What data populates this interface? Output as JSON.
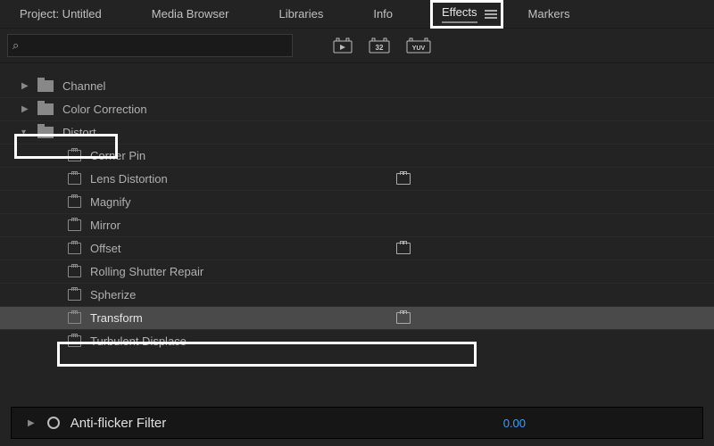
{
  "tabs": {
    "project": "Project: Untitled",
    "media": "Media Browser",
    "libraries": "Libraries",
    "info": "Info",
    "effects": "Effects",
    "markers": "Markers"
  },
  "search": {
    "placeholder": ""
  },
  "badges": {
    "b32": "32",
    "yuv": "YUV"
  },
  "tree": {
    "channel": "Channel",
    "color_correction": "Color Correction",
    "distort": "Distort",
    "items": {
      "corner_pin": "Corner Pin",
      "lens_distortion": "Lens Distortion",
      "magnify": "Magnify",
      "mirror": "Mirror",
      "offset": "Offset",
      "rolling_shutter": "Rolling Shutter Repair",
      "spherize": "Spherize",
      "transform": "Transform",
      "turbulent_displace": "Turbulent Displace"
    }
  },
  "bottom": {
    "label": "Anti-flicker Filter",
    "value": "0.00"
  }
}
